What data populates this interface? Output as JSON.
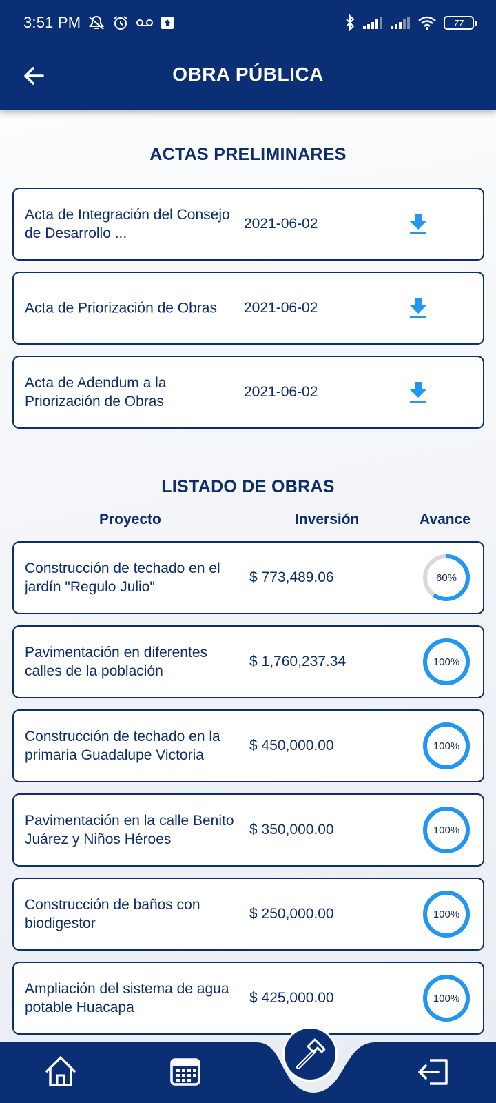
{
  "status_bar": {
    "time": "3:51 PM",
    "battery": "77",
    "icons": [
      "muted-alert-icon",
      "alarm-icon",
      "voicemail-icon",
      "upload-icon",
      "bluetooth-icon",
      "signal-icon",
      "signal-icon",
      "wifi-icon",
      "battery-icon"
    ]
  },
  "header": {
    "title": "OBRA PÚBLICA",
    "back_icon": "arrow-left-icon"
  },
  "actas": {
    "title": "ACTAS PRELIMINARES",
    "items": [
      {
        "name": "Acta de Integración del Consejo de Desarrollo ...",
        "date": "2021-06-02"
      },
      {
        "name": "Acta de Priorización de Obras",
        "date": "2021-06-02"
      },
      {
        "name": "Acta de Adendum a la Priorización de Obras",
        "date": "2021-06-02"
      }
    ]
  },
  "obras": {
    "title": "LISTADO DE OBRAS",
    "columns": {
      "proyecto": "Proyecto",
      "inversion": "Inversión",
      "avance": "Avance"
    },
    "items": [
      {
        "name": "Construcción de techado en el jardín \"Regulo Julio\"",
        "amount": "$ 773,489.06",
        "progress_label": "60%",
        "progress": 0.6
      },
      {
        "name": "Pavimentación en diferentes calles de la población",
        "amount": "$ 1,760,237.34",
        "progress_label": "100%",
        "progress": 1.0
      },
      {
        "name": "Construcción de techado en la primaria Guadalupe Victoria",
        "amount": "$ 450,000.00",
        "progress_label": "100%",
        "progress": 1.0
      },
      {
        "name": "Pavimentación en la calle Benito Juárez y Niños Héroes",
        "amount": "$ 350,000.00",
        "progress_label": "100%",
        "progress": 1.0
      },
      {
        "name": "Construcción de baños con biodigestor",
        "amount": "$ 250,000.00",
        "progress_label": "100%",
        "progress": 1.0
      },
      {
        "name": "Ampliación del sistema de agua potable Huacapa",
        "amount": "$ 425,000.00",
        "progress_label": "100%",
        "progress": 1.0
      }
    ]
  },
  "bottom_nav": {
    "items": [
      "home-icon",
      "calendar-icon",
      "hammer-icon",
      "logout-icon"
    ],
    "active": "hammer-icon"
  },
  "colors": {
    "primary": "#0a2f74",
    "accent": "#2196f3",
    "track": "#d9d9d9"
  }
}
